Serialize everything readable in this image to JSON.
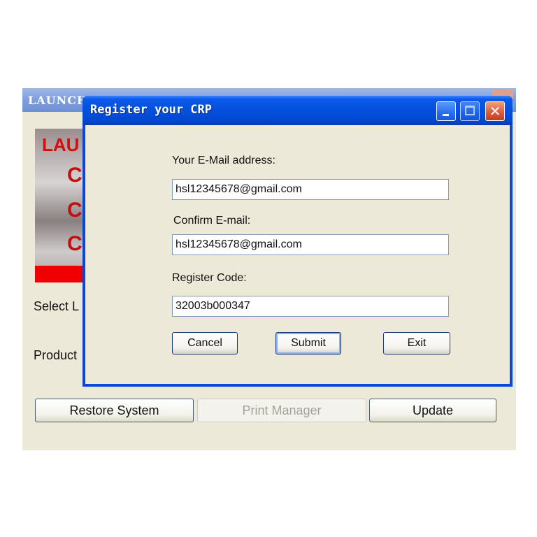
{
  "background_window": {
    "title": "LAUNCH",
    "banner": {
      "top_text": "LAU",
      "letters": [
        "C",
        "C",
        "C"
      ]
    },
    "labels": {
      "select": "Select L",
      "product": "Product"
    },
    "buttons": {
      "restore": "Restore System",
      "print": "Print Manager",
      "update": "Update"
    }
  },
  "dialog": {
    "title": "Register your CRP",
    "fields": {
      "email_label": "Your E-Mail address:",
      "email_value": "hsl12345678@gmail.com",
      "confirm_label": "Confirm E-mail:",
      "confirm_value": "hsl12345678@gmail.com",
      "code_label": "Register Code:",
      "code_value": "32003b000347"
    },
    "buttons": {
      "cancel": "Cancel",
      "submit": "Submit",
      "exit": "Exit"
    }
  },
  "colors": {
    "titlebar_blue": "#0450dc",
    "window_bg": "#ece9d8",
    "banner_red": "#f00000",
    "close_red": "#e06040"
  },
  "icons": {
    "minimize": "minimize-icon",
    "maximize": "maximize-icon",
    "close": "close-icon"
  }
}
